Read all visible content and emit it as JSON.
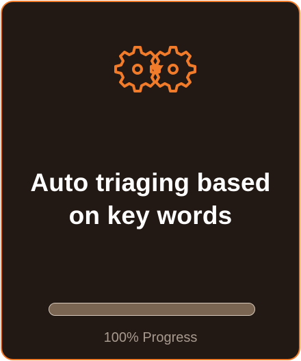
{
  "card": {
    "title_line1": "Auto triaging based",
    "title_line2": "on key words",
    "icon": "gears-icon",
    "accent_color": "#f07b2a",
    "background_color": "#231914"
  },
  "progress": {
    "value": 1.0,
    "label": "100% Progress"
  }
}
